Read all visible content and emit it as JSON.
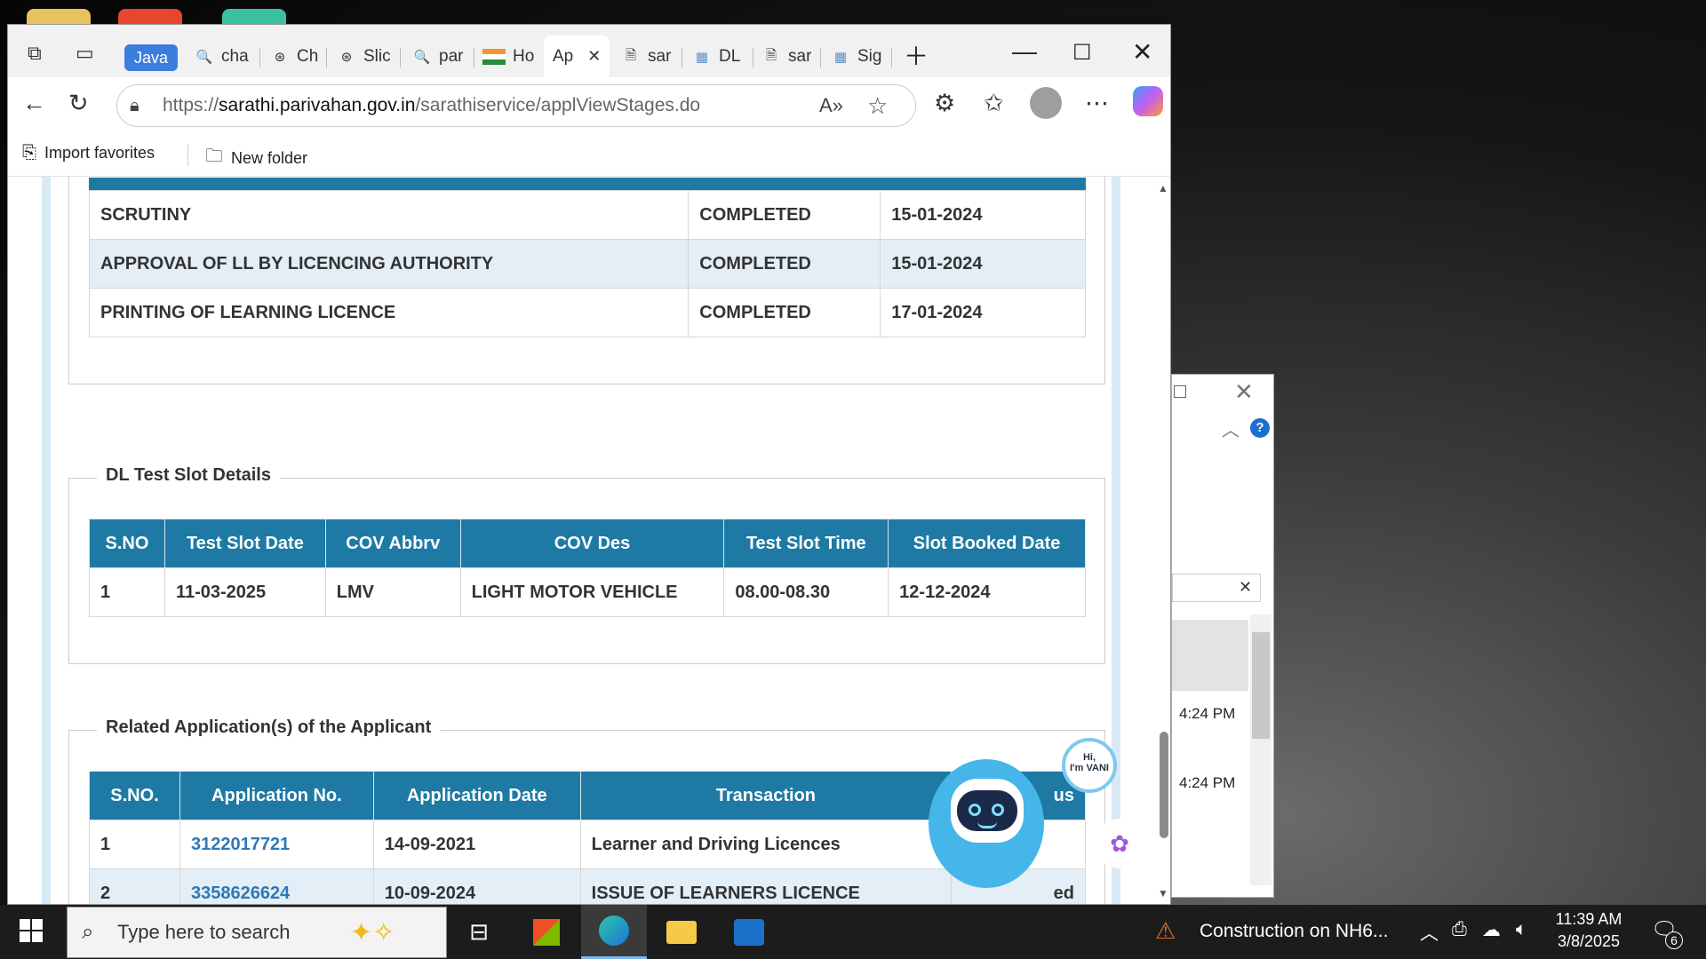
{
  "browser": {
    "tabs": [
      {
        "label": "cha",
        "icon": "search-icon"
      },
      {
        "label": "Ch",
        "icon": "chatgpt-icon"
      },
      {
        "label": "Slic",
        "icon": "chatgpt-icon"
      },
      {
        "label": "par",
        "icon": "search-icon"
      },
      {
        "label": "Ho",
        "icon": "india-flag-icon"
      },
      {
        "label": "Ap",
        "icon": "",
        "active": true
      },
      {
        "label": "sar",
        "icon": "document-icon"
      },
      {
        "label": "DL",
        "icon": "sarathi-icon"
      },
      {
        "label": "sar",
        "icon": "document-icon"
      },
      {
        "label": "Sig",
        "icon": "sarathi-icon"
      }
    ],
    "java_tab": "Java",
    "address": {
      "prefix": "https://",
      "host": "sarathi.parivahan.gov.in",
      "path": "/sarathiservice/applViewStages.do"
    },
    "favorites": [
      {
        "label": "Import favorites",
        "icon": "import-icon"
      },
      {
        "label": "New folder",
        "icon": "folder-icon"
      }
    ]
  },
  "stages": {
    "rows": [
      {
        "stage": "SCRUTINY",
        "status": "COMPLETED",
        "date": "15-01-2024"
      },
      {
        "stage": "APPROVAL OF LL BY LICENCING AUTHORITY",
        "status": "COMPLETED",
        "date": "15-01-2024"
      },
      {
        "stage": "PRINTING OF LEARNING LICENCE",
        "status": "COMPLETED",
        "date": "17-01-2024"
      }
    ]
  },
  "dl_slot": {
    "legend": "DL Test Slot Details",
    "headers": [
      "S.NO",
      "Test Slot Date",
      "COV Abbrv",
      "COV Des",
      "Test Slot Time",
      "Slot Booked Date"
    ],
    "rows": [
      [
        "1",
        "11-03-2025",
        "LMV",
        "LIGHT MOTOR VEHICLE",
        "08.00-08.30",
        "12-12-2024"
      ]
    ]
  },
  "related": {
    "legend": "Related Application(s) of the Applicant",
    "headers": [
      "S.NO.",
      "Application No.",
      "Application Date",
      "Transaction",
      "Status"
    ],
    "header_visible": [
      "S.NO.",
      "Application No.",
      "Application Date",
      "Transaction",
      "us"
    ],
    "rows": [
      {
        "sno": "1",
        "app_no": "3122017721",
        "date": "14-09-2021",
        "transaction": "Learner and Driving Licences",
        "status": ""
      },
      {
        "sno": "2",
        "app_no": "3358626624",
        "date": "10-09-2024",
        "transaction": "ISSUE OF LEARNERS LICENCE",
        "status": "ed"
      }
    ]
  },
  "vani": {
    "greeting_line1": "Hi,",
    "greeting_line2": "I'm VANI"
  },
  "side_window": {
    "times": [
      "4:24 PM",
      "4:24 PM"
    ]
  },
  "taskbar": {
    "search_placeholder": "Type here to search",
    "news": "Construction on NH6...",
    "clock_time": "11:39 AM",
    "clock_date": "3/8/2025",
    "notification_count": "6"
  }
}
